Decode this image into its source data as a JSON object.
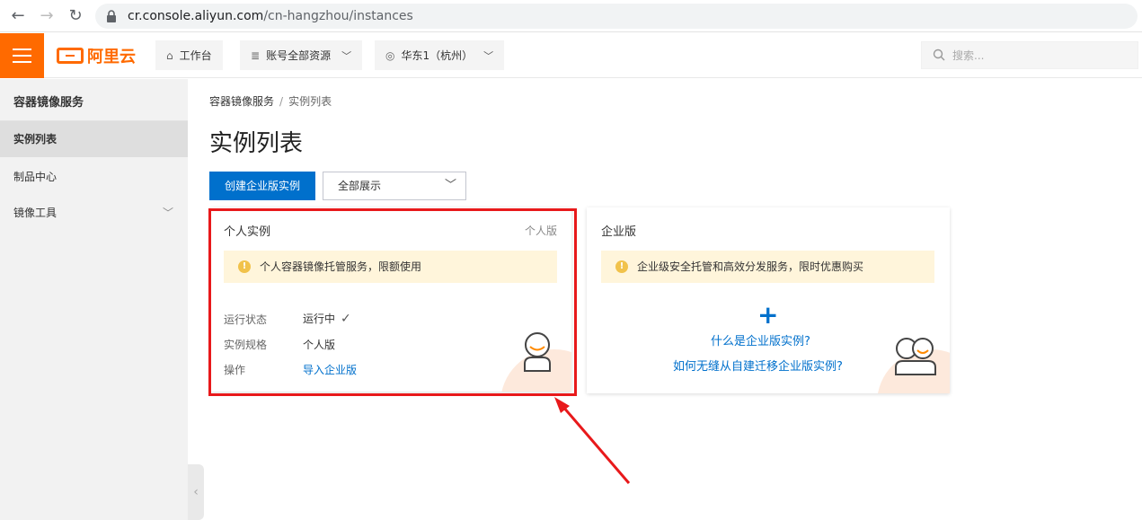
{
  "browser": {
    "url_host": "cr.console.aliyun.com",
    "url_path": "/cn-hangzhou/instances"
  },
  "topbar": {
    "logo_text": "阿里云",
    "workbench_label": "工作台",
    "resources_label": "账号全部资源",
    "region_label": "华东1（杭州）",
    "search_placeholder": "搜索..."
  },
  "sidebar": {
    "title": "容器镜像服务",
    "items": [
      {
        "label": "实例列表",
        "active": true
      },
      {
        "label": "制品中心"
      },
      {
        "label": "镜像工具",
        "expandable": true
      }
    ]
  },
  "breadcrumb": {
    "root": "容器镜像服务",
    "separator": "/",
    "current": "实例列表"
  },
  "page": {
    "title": "实例列表",
    "create_button": "创建企业版实例",
    "filter_value": "全部展示"
  },
  "personal_card": {
    "title": "个人实例",
    "tag": "个人版",
    "notice": "个人容器镜像托管服务，限额使用",
    "rows": [
      {
        "label": "运行状态",
        "value": "运行中"
      },
      {
        "label": "实例规格",
        "value": "个人版"
      },
      {
        "label": "操作",
        "value": "导入企业版"
      }
    ]
  },
  "enterprise_card": {
    "title": "企业版",
    "notice": "企业级安全托管和高效分发服务，限时优惠购买",
    "link_what": "什么是企业版实例?",
    "link_migrate": "如何无缝从自建迁移企业版实例?"
  },
  "colors": {
    "brand": "#ff6a00",
    "primary": "#0070cc",
    "annotation": "#e8191b",
    "notice_bg": "#fff5db"
  },
  "icons": [
    "back-icon",
    "forward-icon",
    "reload-icon",
    "lock-icon",
    "menu-icon",
    "home-icon",
    "resource-icon",
    "location-icon",
    "search-icon",
    "warning-icon",
    "check-icon",
    "plus-icon",
    "avatar-icon",
    "collapse-icon"
  ]
}
